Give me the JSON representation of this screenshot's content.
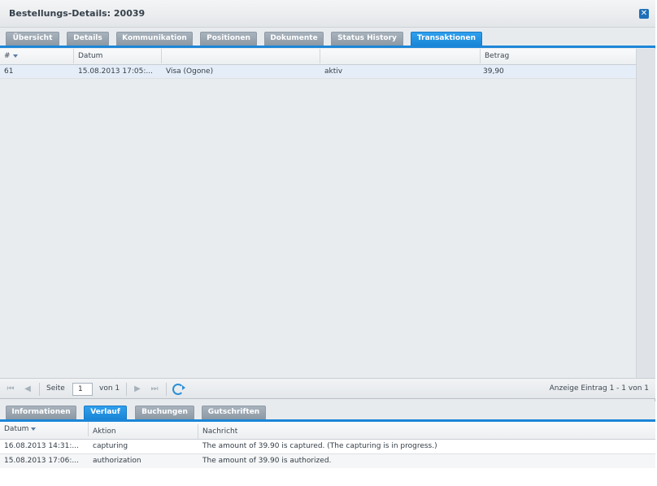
{
  "window": {
    "title": "Bestellungs-Details: 20039",
    "close_icon": "close-icon"
  },
  "top_tabs": [
    {
      "label": "Übersicht",
      "active": false
    },
    {
      "label": "Details",
      "active": false
    },
    {
      "label": "Kommunikation",
      "active": false
    },
    {
      "label": "Positionen",
      "active": false
    },
    {
      "label": "Dokumente",
      "active": false
    },
    {
      "label": "Status History",
      "active": false
    },
    {
      "label": "Transaktionen",
      "active": true
    }
  ],
  "transactions": {
    "columns": [
      "#",
      "Datum",
      "",
      "",
      "Betrag"
    ],
    "sort_column": "#",
    "rows": [
      {
        "id": "61",
        "date": "15.08.2013 17:05:...",
        "method": "Visa (Ogone)",
        "status": "aktiv",
        "amount": "39,90"
      }
    ]
  },
  "paging": {
    "page_label": "Seite",
    "page_value": "1",
    "of_label": "von 1",
    "info": "Anzeige Eintrag 1 - 1 von 1"
  },
  "bottom_tabs": [
    {
      "label": "Informationen",
      "active": false
    },
    {
      "label": "Verlauf",
      "active": true
    },
    {
      "label": "Buchungen",
      "active": false
    },
    {
      "label": "Gutschriften",
      "active": false
    }
  ],
  "history": {
    "columns": [
      "Datum",
      "Aktion",
      "Nachricht"
    ],
    "sort_column": "Datum",
    "rows": [
      {
        "date": "16.08.2013 14:31:...",
        "action": "capturing",
        "message": "The amount of 39.90 is captured. (The capturing is in progress.)"
      },
      {
        "date": "15.08.2013 17:06:...",
        "action": "authorization",
        "message": "The amount of 39.90 is authorized."
      }
    ]
  },
  "colors": {
    "accent": "#1c86d8",
    "tab_inactive": "#8c98a3",
    "selected_row": "#e5eef8"
  }
}
